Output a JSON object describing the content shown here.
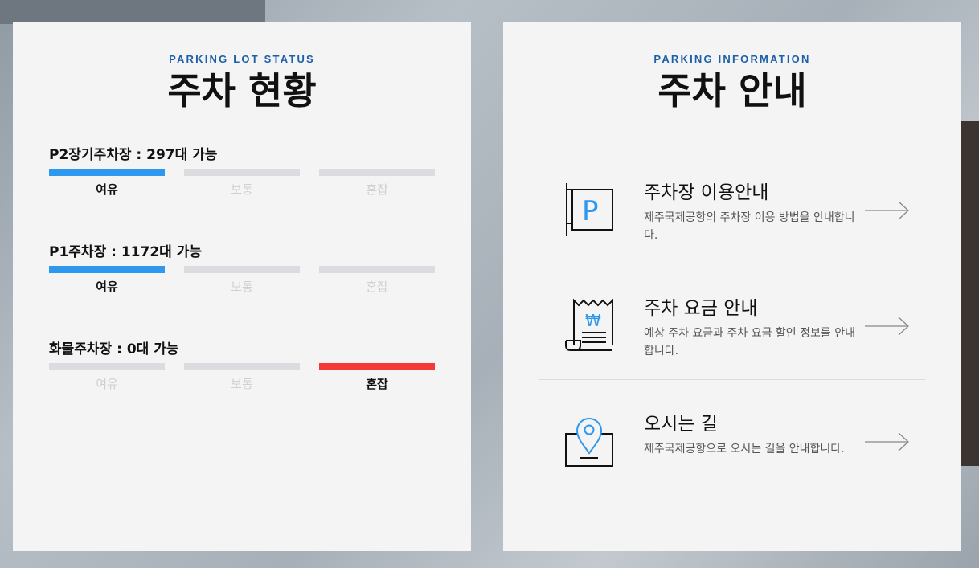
{
  "left": {
    "eyebrow": "PARKING LOT STATUS",
    "title": "주차 현황",
    "lots": [
      {
        "title": "P2장기주차장 : 297대 가능",
        "levels": [
          "여유",
          "보통",
          "혼잡"
        ],
        "active": 0,
        "active_color": "#2e97ee"
      },
      {
        "title": "P1주차장 : 1172대 가능",
        "levels": [
          "여유",
          "보통",
          "혼잡"
        ],
        "active": 0,
        "active_color": "#2e97ee"
      },
      {
        "title": "화물주차장 : 0대 가능",
        "levels": [
          "여유",
          "보통",
          "혼잡"
        ],
        "active": 2,
        "active_color": "#f53838"
      }
    ]
  },
  "right": {
    "eyebrow": "PARKING INFORMATION",
    "title": "주차 안내",
    "items": [
      {
        "icon": "parking-sign-icon",
        "title": "주차장 이용안내",
        "desc": "제주국제공항의 주차장 이용 방법을 안내합니다."
      },
      {
        "icon": "receipt-won-icon",
        "title": "주차 요금 안내",
        "desc": "예상 주차 요금과 주차 요금 할인 정보를 안내합니다."
      },
      {
        "icon": "location-pin-icon",
        "title": "오시는 길",
        "desc": "제주국제공항으로 오시는 길을 안내합니다."
      }
    ]
  },
  "colors": {
    "accent_blue": "#2e97ee",
    "eyebrow_blue": "#1d5fa8",
    "busy_red": "#f53838",
    "inactive": "#dcdce0"
  }
}
